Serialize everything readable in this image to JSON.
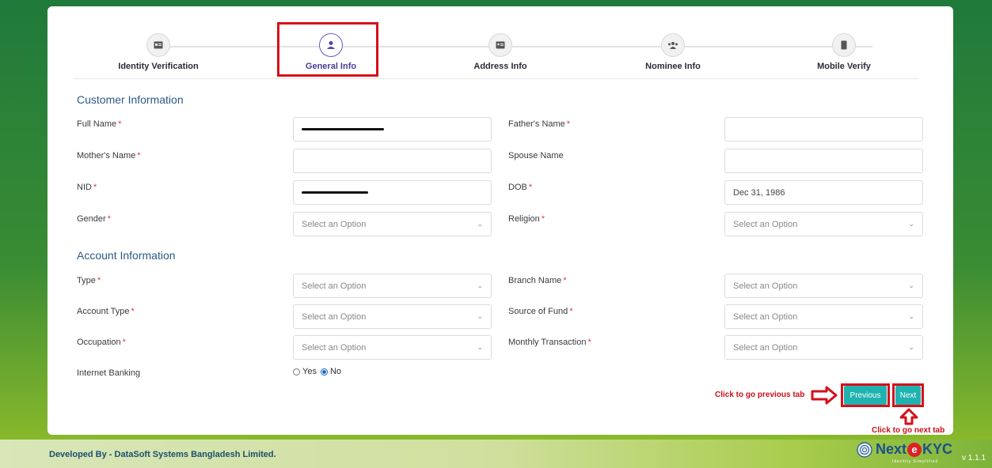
{
  "stepper": {
    "steps": [
      {
        "label": "Identity Verification",
        "icon": "id-card-icon"
      },
      {
        "label": "General Info",
        "icon": "user-icon"
      },
      {
        "label": "Address Info",
        "icon": "address-card-icon"
      },
      {
        "label": "Nominee Info",
        "icon": "users-icon"
      },
      {
        "label": "Mobile Verify",
        "icon": "mobile-icon"
      }
    ],
    "active": "General Info"
  },
  "customer": {
    "title": "Customer Information",
    "full_name_label": "Full Name",
    "fathers_name_label": "Father's Name",
    "mothers_name_label": "Mother's Name",
    "spouse_name_label": "Spouse Name",
    "nid_label": "NID",
    "dob_label": "DOB",
    "dob_value": "Dec 31, 1986",
    "gender_label": "Gender",
    "religion_label": "Religion"
  },
  "account": {
    "title": "Account Information",
    "type_label": "Type",
    "branch_name_label": "Branch Name",
    "account_type_label": "Account Type",
    "source_of_fund_label": "Source of Fund",
    "occupation_label": "Occupation",
    "monthly_transaction_label": "Monthly Transaction",
    "internet_banking_label": "Internet Banking",
    "yes_label": "Yes",
    "no_label": "No"
  },
  "select_placeholder": "Select an Option",
  "required_mark": "*",
  "buttons": {
    "previous": "Previous",
    "next": "Next"
  },
  "annotations": {
    "previous_hint": "Click to go previous tab",
    "next_hint": "Click to go next tab"
  },
  "footer": {
    "developer": "Developed By - DataSoft Systems Bangladesh Limited.",
    "logo_next": "Next",
    "logo_e": "e",
    "logo_kyc": "KYC",
    "logo_sub": "Identity Simplified",
    "version": "v 1.1.1"
  },
  "colors": {
    "accent": "#1fb3b0",
    "annotation_red": "#d6101b",
    "section_title": "#2c5a85"
  }
}
